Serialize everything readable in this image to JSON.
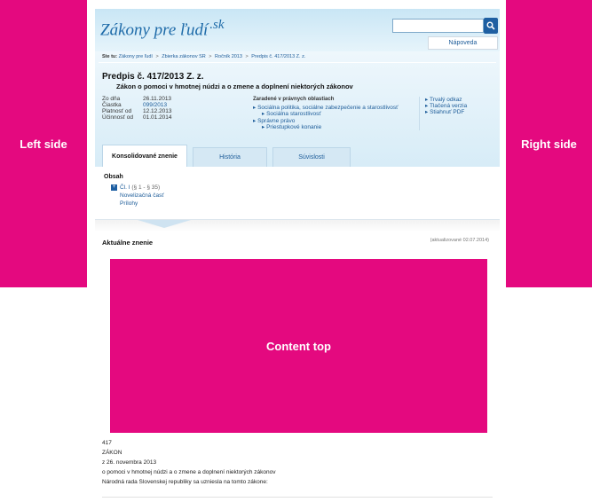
{
  "ads": {
    "left_label": "Left side",
    "right_label": "Right side",
    "content_label": "Content top"
  },
  "header": {
    "logo_text": "Zákony pre ľudí",
    "logo_suffix": ".sk",
    "search_placeholder": "",
    "search_icon": "magnifier-icon",
    "help_label": "Nápoveda"
  },
  "breadcrumb": {
    "label": "Ste tu:",
    "items": [
      "Zákony pre ľudí",
      "Zbierka zákonov SR",
      "Ročník 2013",
      "Predpis č. 417/2013 Z. z."
    ],
    "separator": ">"
  },
  "document": {
    "title": "Predpis č. 417/2013 Z. z.",
    "subtitle": "Zákon o pomoci v hmotnej núdzi a o zmene a doplnení niektorých zákonov",
    "meta": [
      {
        "label": "Zo dňa",
        "value": "26.11.2013"
      },
      {
        "label": "Čiastka",
        "value": "099/2013"
      },
      {
        "label": "Platnosť od",
        "value": "12.12.2013"
      },
      {
        "label": "Účinnosť od",
        "value": "01.01.2014"
      }
    ],
    "areas_title": "Zaradené v právnych oblastiach",
    "areas": [
      "Sociálna politika, sociálne zabezpečenie a starostlivosť",
      "Sociálna starostlivosť",
      "Správne právo",
      "Priestupkové konanie"
    ],
    "side_links": [
      "Trvalý odkaz",
      "Tlačená verzia",
      "Stiahnuť PDF"
    ]
  },
  "tabs": [
    "Konsolidované znenie",
    "História",
    "Súvislosti"
  ],
  "toc": {
    "title": "Obsah",
    "item_label": "Čl. I",
    "item_range": "(§ 1 - § 35)",
    "links": [
      "Novelizačná časť",
      "Prílohy"
    ]
  },
  "current": {
    "heading": "Aktuálne znenie",
    "updated": "(aktualizované 02.07.2014)"
  },
  "law_text": [
    "417",
    "ZÁKON",
    "z 26. novembra 2013",
    "o pomoci v hmotnej núdzi a o zmene a doplnení niektorých zákonov",
    "Národná rada Slovenskej republiky sa uzniesla na tomto zákone:"
  ],
  "colors": {
    "ad_magenta": "#e4097f",
    "link_blue": "#1d5c99",
    "header_blue": "#c9e6f5"
  }
}
